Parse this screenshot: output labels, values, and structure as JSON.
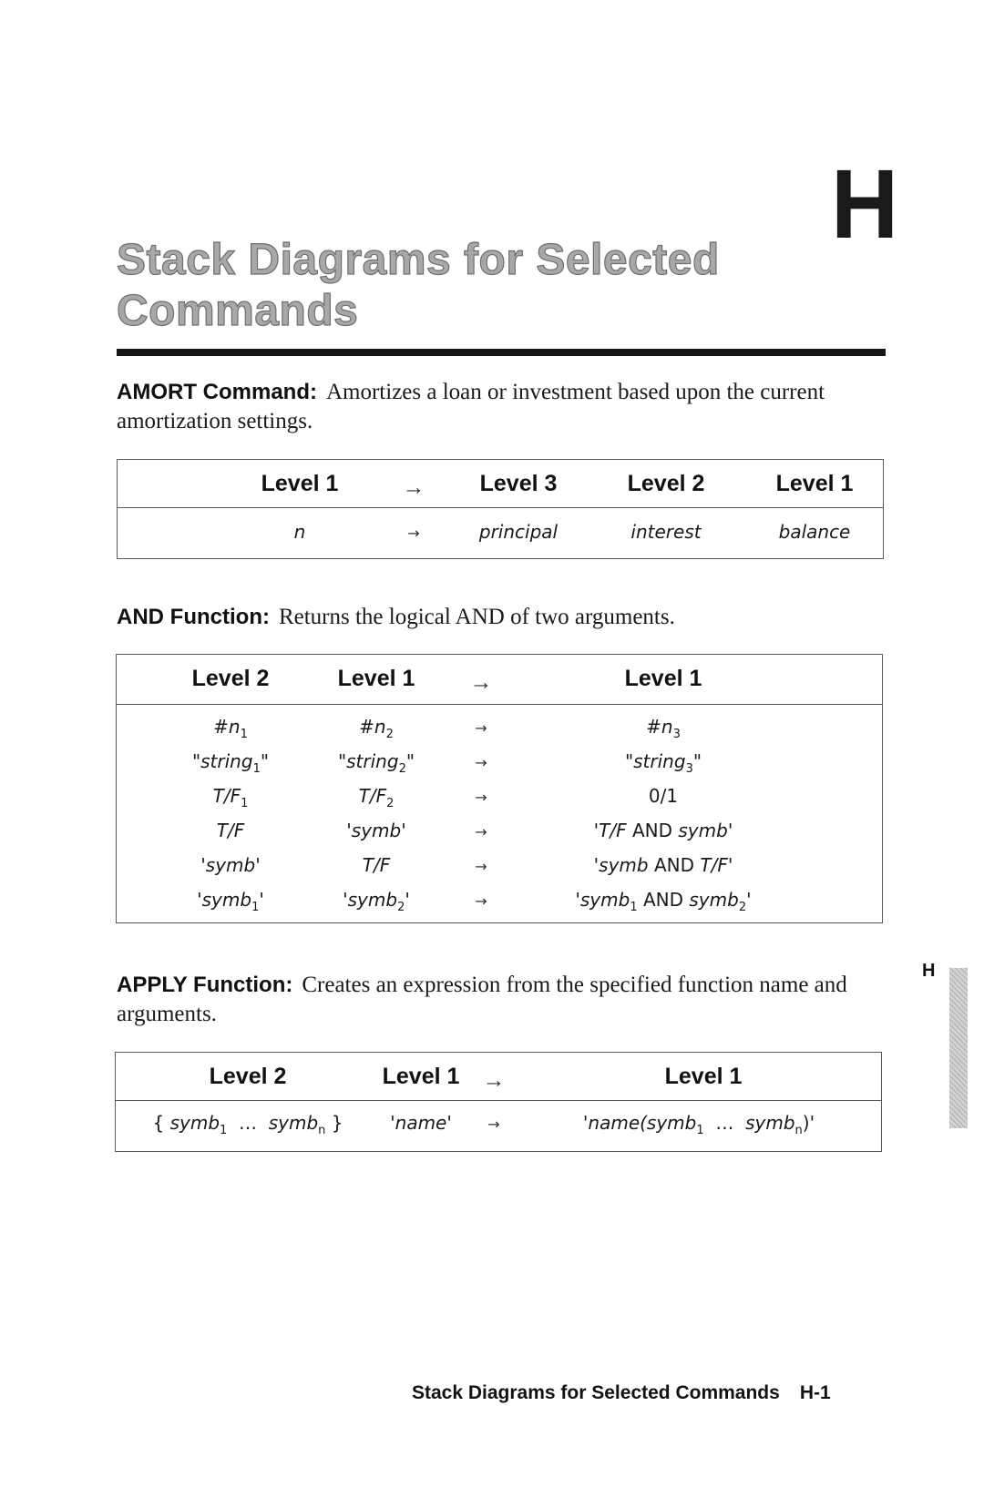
{
  "chapter_letter": "H",
  "title": "Stack Diagrams for Selected Commands",
  "sections": [
    {
      "name": "AMORT Command:",
      "description": "Amortizes a loan or investment based upon the current amortization settings.",
      "table": {
        "headers": [
          "Level 1",
          "→",
          "Level 3",
          "Level 2",
          "Level 1"
        ],
        "rows": [
          [
            "n",
            "→",
            "principal",
            "interest",
            "balance"
          ]
        ]
      }
    },
    {
      "name": "AND Function:",
      "description": "Returns the logical AND of two arguments.",
      "table": {
        "headers": [
          "Level 2",
          "Level 1",
          "→",
          "Level 1"
        ],
        "rows": [
          [
            "#n1",
            "#n2",
            "→",
            "#n3"
          ],
          [
            "\"string1\"",
            "\"string2\"",
            "→",
            "\"string3\""
          ],
          [
            "T/F1",
            "T/F2",
            "→",
            "0/1"
          ],
          [
            "T/F",
            "'symb'",
            "→",
            "'T/F AND symb'"
          ],
          [
            "'symb'",
            "T/F",
            "→",
            "'symb AND T/F'"
          ],
          [
            "'symb1'",
            "'symb2'",
            "→",
            "'symb1 AND symb2'"
          ]
        ]
      }
    },
    {
      "name": "APPLY Function:",
      "description": "Creates an expression from the specified function name and arguments.",
      "table": {
        "headers": [
          "Level 2",
          "Level 1",
          "→",
          "Level 1"
        ],
        "rows": [
          [
            "{ symb1 … symbn }",
            "'name'",
            "→",
            "'name(symb1 … symbn)'"
          ]
        ]
      }
    }
  ],
  "side_tab": "H",
  "footer": {
    "running_title": "Stack Diagrams for Selected Commands",
    "page_number": "H-1"
  }
}
